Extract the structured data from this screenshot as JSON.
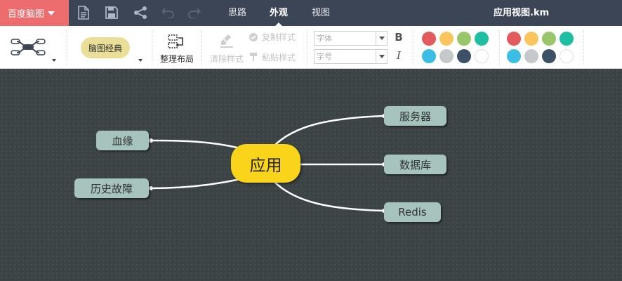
{
  "topbar": {
    "brand": "百度脑图",
    "tabs": [
      {
        "label": "思路",
        "active": false
      },
      {
        "label": "外观",
        "active": true
      },
      {
        "label": "视图",
        "active": false
      }
    ],
    "filename": "应用视图.km",
    "icons": [
      "new-file-icon",
      "save-icon",
      "share-icon",
      "undo-icon",
      "redo-icon"
    ]
  },
  "ribbon": {
    "theme": "脑图经典",
    "layout_label": "整理布局",
    "clear_style": "清除样式",
    "copy_style": "复制样式",
    "paste_style": "粘贴样式",
    "font_placeholder": "字体",
    "size_placeholder": "字号",
    "bold": "B",
    "italic": "I",
    "text_colors": [
      "#e35a5d",
      "#fac55d",
      "#9ac66a",
      "#1dbfa3",
      "#3bbde5",
      "#c6c9cb",
      "#3c5166",
      "#ffffff"
    ],
    "bg_colors": [
      "#e35a5d",
      "#fac55d",
      "#9ac66a",
      "#1dbfa3",
      "#3bbde5",
      "#c6c9cb",
      "#3c5166",
      "#ffffff"
    ]
  },
  "mindmap": {
    "root": "应用",
    "left": [
      "血缘",
      "历史故障"
    ],
    "right": [
      "服务器",
      "数据库",
      "Redis"
    ]
  },
  "colors": {
    "topbar": "#3c4555",
    "brand": "#ed6c6e",
    "root": "#fad31b",
    "node": "#a6c4bd",
    "canvas": "#3b4345"
  }
}
